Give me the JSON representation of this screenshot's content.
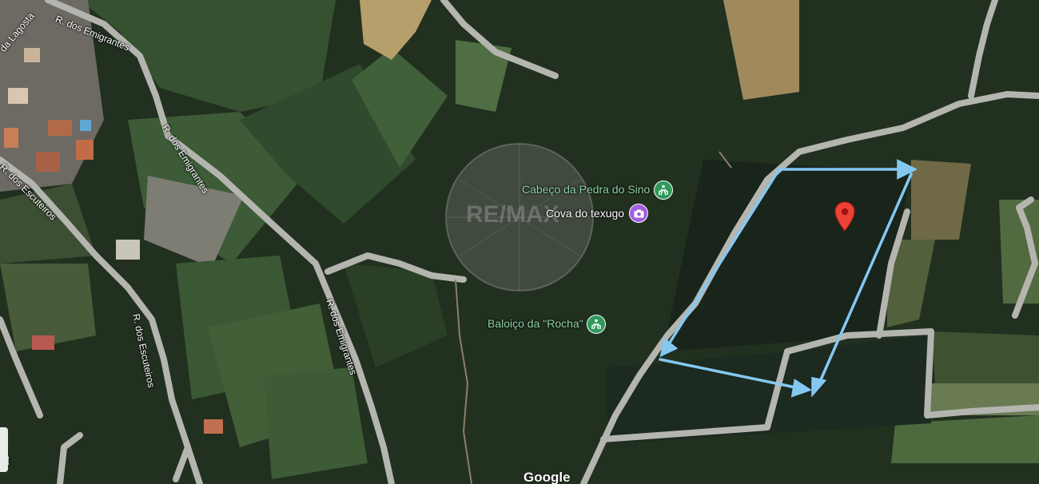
{
  "map": {
    "streets": {
      "lagosta": "da Lagosta",
      "emigrantes_top": "R. dos Emigrantes",
      "emigrantes_mid": "R. dos Emigrantes",
      "emigrantes_low": "R. dos Emigrantes",
      "escuteiros_top": "R. dos Escuteiros",
      "escuteiros_low": "R. dos Escuteiros",
      "las": "as"
    },
    "pois": {
      "cabeco": "Cabeço da Pedra do Sino",
      "cova": "Cova do texugo",
      "baloico": "Baloiço da \"Rocha\""
    },
    "watermark_text": "RE/MAX",
    "attribution": "Google"
  },
  "colors": {
    "forest": "#1f2b1c",
    "field": "#3a5a35",
    "road": "#b5b5b0",
    "arrow": "#84c8f2",
    "marker": "#ea4335",
    "poi_green_text": "#8fd4a3",
    "poi_badge_green": "#2f9a5b",
    "poi_badge_purple": "#a05ee0"
  },
  "icons": {
    "marker": "map-marker-icon",
    "hiking": "hiking-icon",
    "camera": "camera-icon"
  }
}
